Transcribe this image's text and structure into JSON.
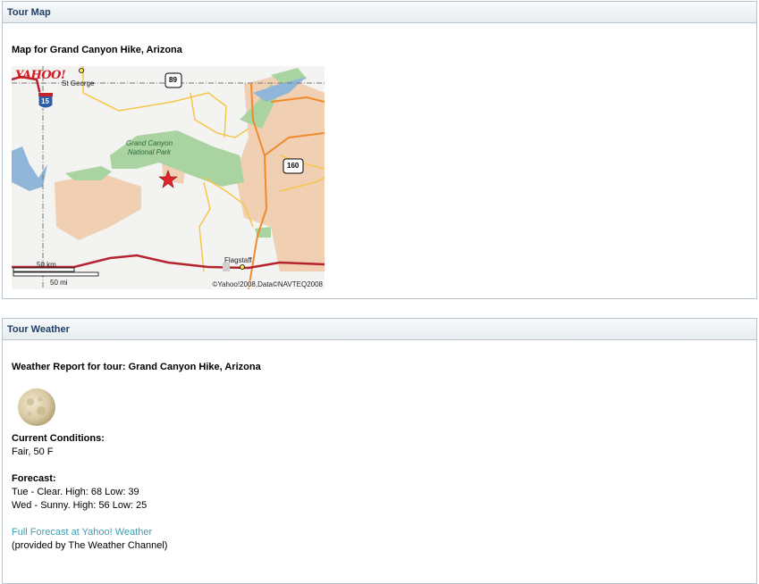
{
  "map_panel": {
    "header": "Tour Map",
    "subtitle": "Map for Grand Canyon Hike, Arizona",
    "map": {
      "logo": "YAHOO!",
      "park_label_line1": "Grand Canyon",
      "park_label_line2": "National Park",
      "city_st_george": "St George",
      "city_flagstaff": "Flagstaff",
      "route_15": "15",
      "route_89": "89",
      "route_160": "160",
      "scale_km": "50 km",
      "scale_mi": "50 mi",
      "copyright": "©Yahoo!2008,Data©NAVTEQ2008"
    }
  },
  "weather_panel": {
    "header": "Tour Weather",
    "subtitle": "Weather Report for tour: Grand Canyon Hike, Arizona",
    "current_label": "Current Conditions:",
    "current_value": "Fair, 50 F",
    "forecast_label": "Forecast:",
    "forecast": [
      "Tue - Clear. High: 68 Low: 39",
      "Wed - Sunny. High: 56 Low: 25"
    ],
    "link_text": "Full Forecast at Yahoo! Weather",
    "provider_text": "(provided by The Weather Channel)"
  }
}
